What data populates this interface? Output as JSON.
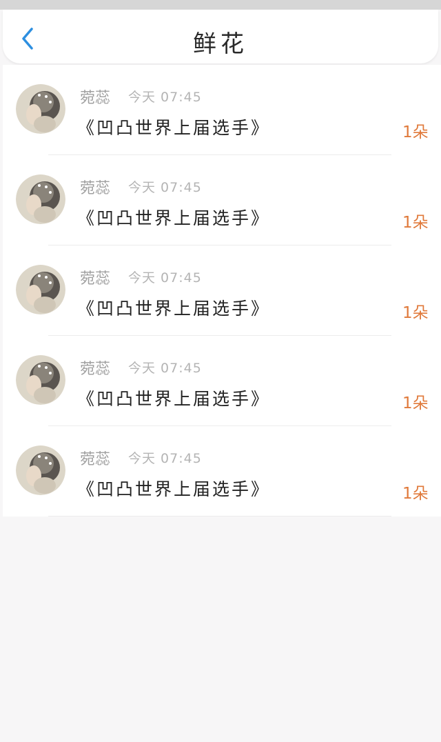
{
  "header": {
    "title": "鲜花"
  },
  "rows": [
    {
      "name": "菀蕊",
      "time": "今天 07:45",
      "title": "《凹凸世界上届选手》",
      "count": "1朵"
    },
    {
      "name": "菀蕊",
      "time": "今天 07:45",
      "title": "《凹凸世界上届选手》",
      "count": "1朵"
    },
    {
      "name": "菀蕊",
      "time": "今天 07:45",
      "title": "《凹凸世界上届选手》",
      "count": "1朵"
    },
    {
      "name": "菀蕊",
      "time": "今天 07:45",
      "title": "《凹凸世界上届选手》",
      "count": "1朵"
    },
    {
      "name": "菀蕊",
      "time": "今天 07:45",
      "title": "《凹凸世界上届选手》",
      "count": "1朵"
    }
  ],
  "colors": {
    "accent": "#2d8fe0",
    "count": "#e0793a"
  },
  "icons": {
    "back": "chevron-left-icon"
  }
}
